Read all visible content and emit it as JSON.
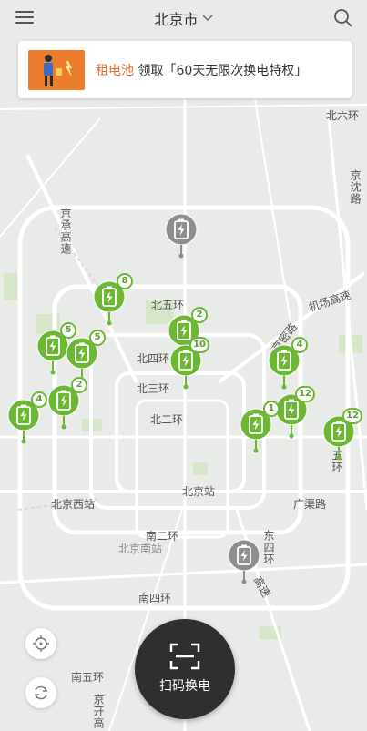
{
  "header": {
    "menu_icon": "menu-icon",
    "city": "北京市",
    "city_chevron_icon": "chevron-down-icon",
    "search_icon": "search-icon"
  },
  "banner": {
    "tag": "租电池",
    "text": "领取「60天无限次换电特权」"
  },
  "map_labels": {
    "beiliuhuan": "北六环",
    "jinghu_road": "京沈路",
    "jingcheng_expressway": "京承高速",
    "airport_expressway": "机场高速",
    "beiwuhuan": "北五环",
    "jingmi_road": "京密路",
    "beisihuan": "北四环",
    "beisanhuan": "北三环",
    "beierhuan": "北二环",
    "wuhuan": "五环",
    "beijing_station": "北京站",
    "beijing_west_station": "北京西站",
    "guangqu_road": "广渠路",
    "nanerhuan": "南二环",
    "beijing_south_station": "北京南站",
    "dongsihuan": "东四环",
    "gaosu": "高速",
    "nansihuan": "南四环",
    "nanwuhuan": "南五环",
    "jingkai_expressway": "京开高"
  },
  "stations": [
    {
      "id": "s1",
      "count": "8",
      "status": "active"
    },
    {
      "id": "s2",
      "count": "5",
      "status": "active"
    },
    {
      "id": "s3",
      "count": "5",
      "status": "active"
    },
    {
      "id": "s4",
      "count": "2",
      "status": "active"
    },
    {
      "id": "s5",
      "count": "4",
      "status": "active"
    },
    {
      "id": "s6",
      "count": "2",
      "status": "active"
    },
    {
      "id": "s7",
      "count": "10",
      "status": "active"
    },
    {
      "id": "s8",
      "count": "4",
      "status": "active"
    },
    {
      "id": "s9",
      "count": "12",
      "status": "active"
    },
    {
      "id": "s10",
      "count": "1",
      "status": "active"
    },
    {
      "id": "s11",
      "count": "12",
      "status": "active"
    },
    {
      "id": "s12",
      "count": "",
      "status": "offline"
    },
    {
      "id": "s13",
      "count": "",
      "status": "offline"
    }
  ],
  "controls": {
    "locate_icon": "crosshair-icon",
    "refresh_icon": "refresh-icon",
    "scan_icon": "scan-frame-icon",
    "scan_label": "扫码换电"
  },
  "colors": {
    "accent": "#e2702c",
    "station_green": "#6db734",
    "station_offline": "#8e8e8e",
    "scan_button": "#2f2f2f"
  }
}
